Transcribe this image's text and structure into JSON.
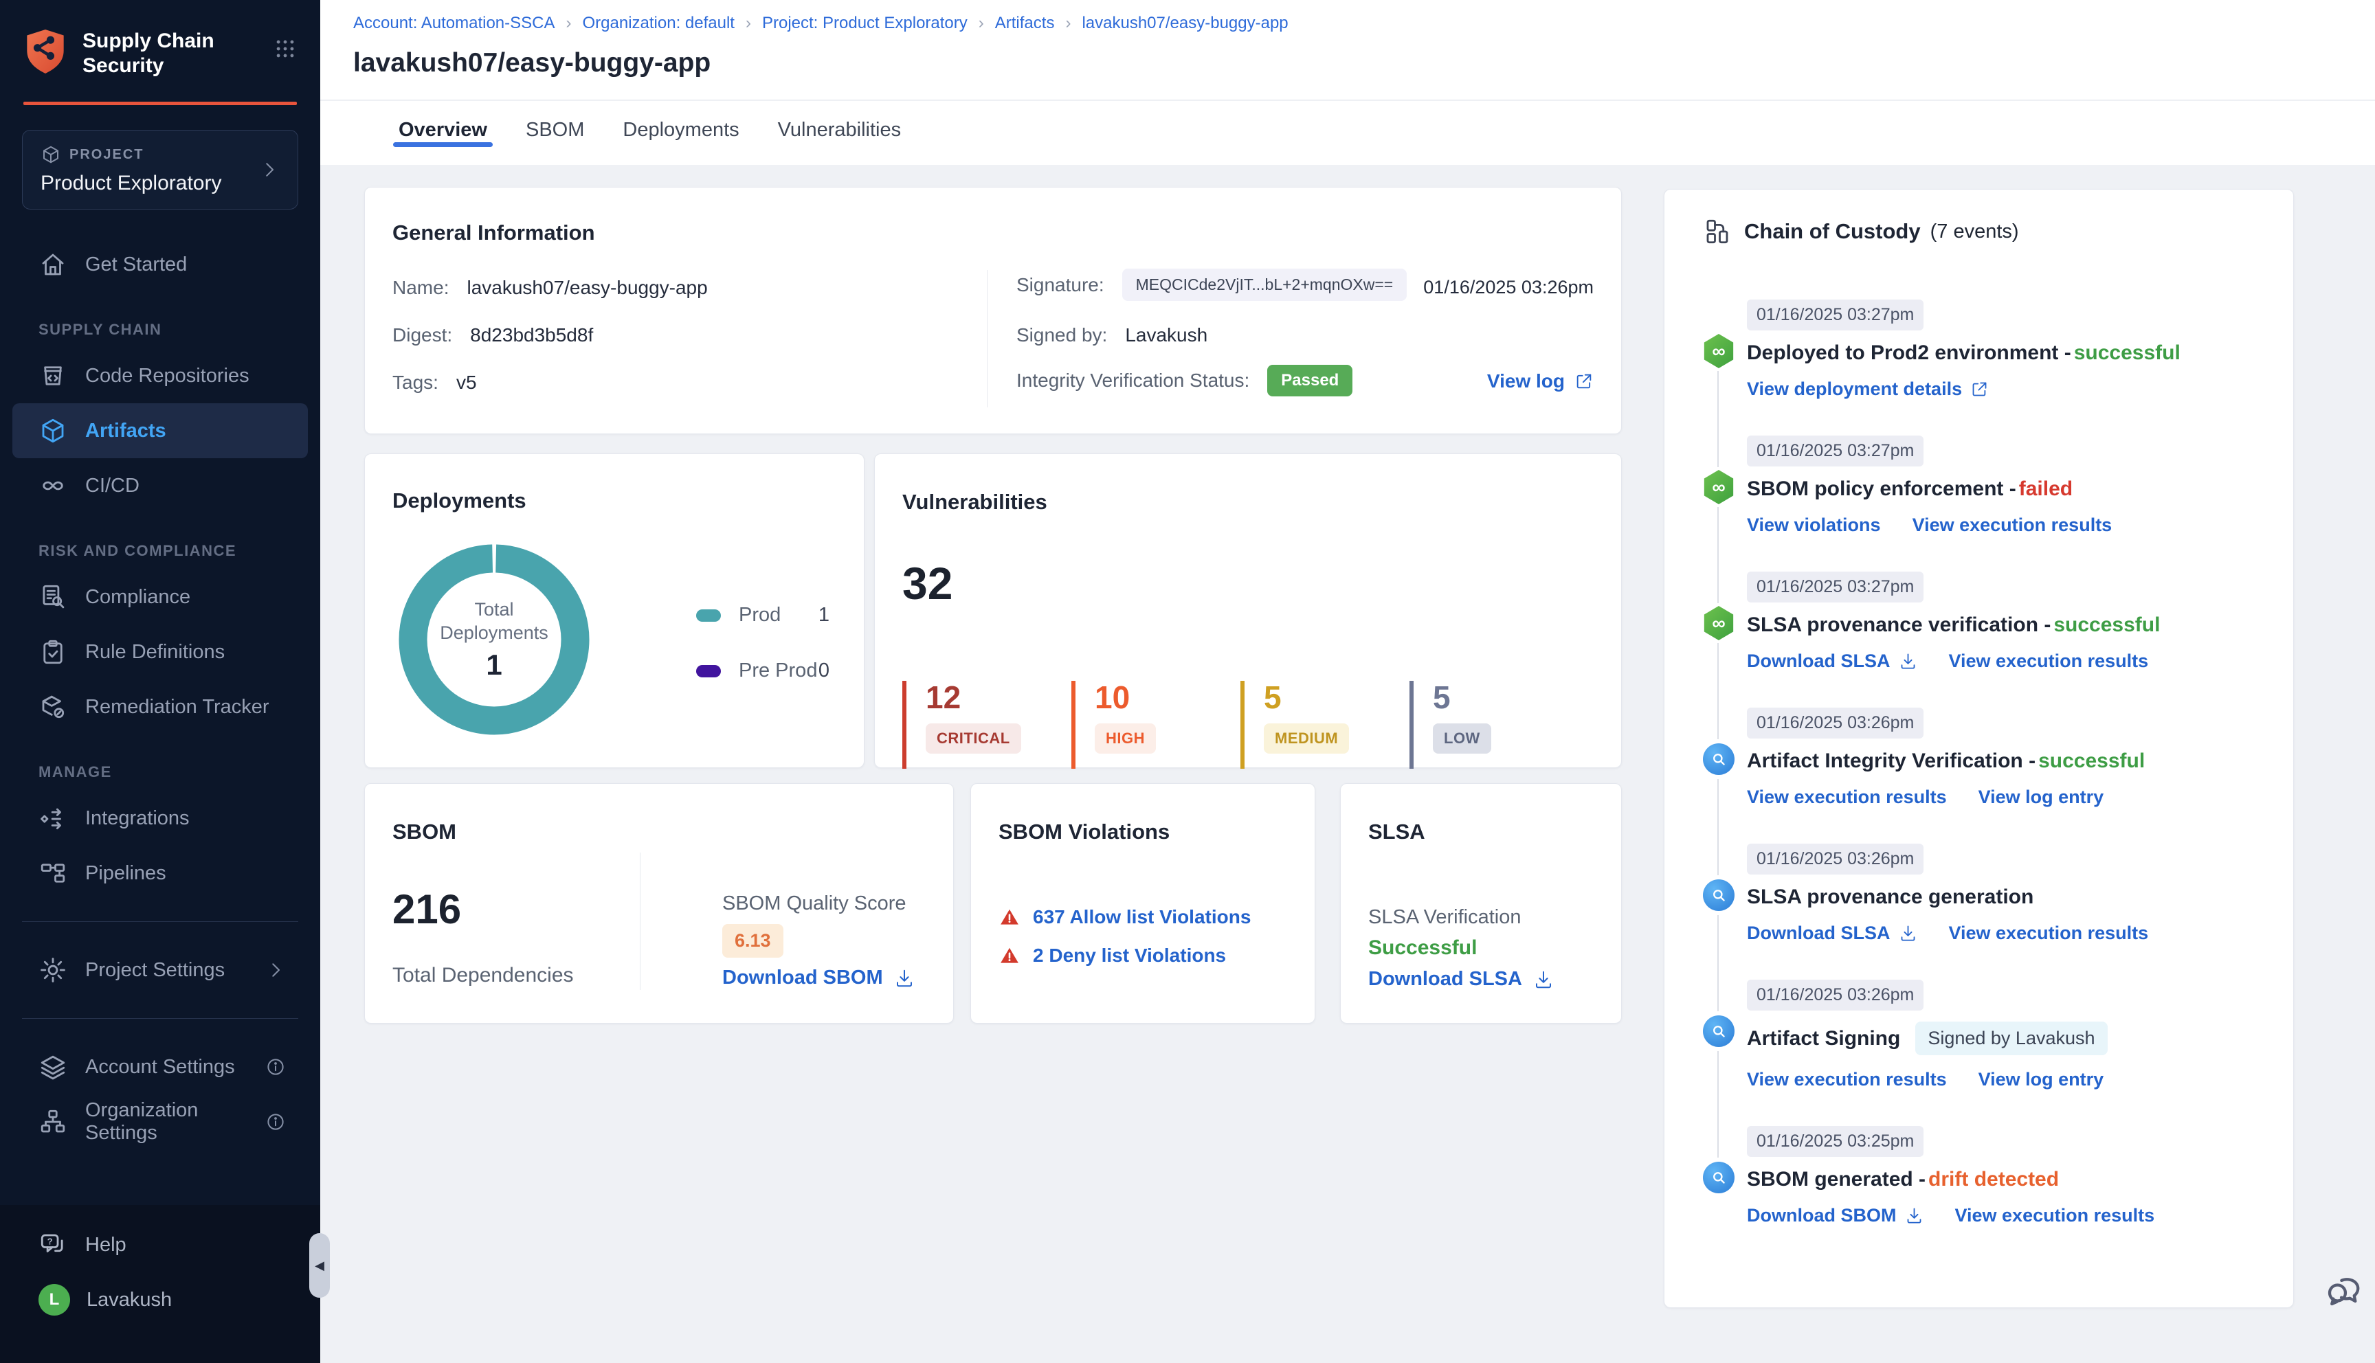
{
  "colors": {
    "accent_red": "#e8543c",
    "sidebar_active_blue": "#42a5f5",
    "breadcrumb_blue": "#2e6bd9",
    "link_blue": "#2463cc",
    "tab_underline": "#3a72e0",
    "passed_green": "#57ab57",
    "success_green": "#3e9d45",
    "failed_red": "#d6392e",
    "drift_orange": "#e7612e",
    "teal": "#49a4ad",
    "purple": "#41149e",
    "score_orange": "#e0703c"
  },
  "sidebar": {
    "product_name": "Supply Chain Security",
    "project_label": "PROJECT",
    "project_name": "Product Exploratory",
    "groups": [
      {
        "items": [
          {
            "label": "Get Started",
            "icon": "home"
          }
        ]
      },
      {
        "section": "SUPPLY CHAIN",
        "items": [
          {
            "label": "Code Repositories",
            "icon": "repo"
          },
          {
            "label": "Artifacts",
            "icon": "cube",
            "active": true
          },
          {
            "label": "CI/CD",
            "icon": "infinity"
          }
        ]
      },
      {
        "section": "RISK AND COMPLIANCE",
        "items": [
          {
            "label": "Compliance",
            "icon": "doc-search"
          },
          {
            "label": "Rule Definitions",
            "icon": "clipboard-check"
          },
          {
            "label": "Remediation Tracker",
            "icon": "box-tag"
          }
        ]
      },
      {
        "section": "MANAGE",
        "items": [
          {
            "label": "Integrations",
            "icon": "share-arrows"
          },
          {
            "label": "Pipelines",
            "icon": "pipeline"
          }
        ]
      }
    ],
    "settings_item": {
      "label": "Project Settings",
      "icon": "gear"
    },
    "admin_items": [
      {
        "label": "Account Settings",
        "icon": "layers"
      },
      {
        "label": "Organization Settings",
        "icon": "org-chart"
      }
    ],
    "help_label": "Help",
    "user": {
      "name": "Lavakush",
      "initial": "L"
    }
  },
  "breadcrumb": [
    "Account: Automation-SSCA",
    "Organization: default",
    "Project: Product Exploratory",
    "Artifacts",
    "lavakush07/easy-buggy-app"
  ],
  "page": {
    "title": "lavakush07/easy-buggy-app",
    "tabs": [
      {
        "label": "Overview",
        "active": true
      },
      {
        "label": "SBOM"
      },
      {
        "label": "Deployments"
      },
      {
        "label": "Vulnerabilities"
      }
    ]
  },
  "general_info": {
    "title": "General Information",
    "name_label": "Name:",
    "name": "lavakush07/easy-buggy-app",
    "digest_label": "Digest:",
    "digest": "8d23bd3b5d8f",
    "tags_label": "Tags:",
    "tags": "v5",
    "signature_label": "Signature:",
    "signature": "MEQCICde2VjIT...bL+2+mqnOXw==",
    "signature_date": "01/16/2025 03:26pm",
    "signed_by_label": "Signed by:",
    "signed_by": "Lavakush",
    "integrity_label": "Integrity Verification Status:",
    "integrity_status": "Passed",
    "view_log_label": "View log"
  },
  "deployments": {
    "title": "Deployments",
    "center_line1": "Total",
    "center_line2": "Deployments",
    "total": "1",
    "legend": [
      {
        "label": "Prod",
        "value": "1",
        "color": "#49a4ad"
      },
      {
        "label": "Pre Prod",
        "value": "0",
        "color": "#41149e"
      }
    ]
  },
  "vulnerabilities": {
    "title": "Vulnerabilities",
    "total": "32",
    "severities": [
      {
        "count": "12",
        "label": "CRITICAL",
        "number_color": "#a63a32",
        "bar_color": "#cc3d2e",
        "badge_bg": "#f7e9e8",
        "badge_color": "#a63a32"
      },
      {
        "count": "10",
        "label": "HIGH",
        "number_color": "#ec5b2d",
        "bar_color": "#ec5b2d",
        "badge_bg": "#fceee8",
        "badge_color": "#ec5b2d"
      },
      {
        "count": "5",
        "label": "MEDIUM",
        "number_color": "#cfa022",
        "bar_color": "#cfa022",
        "badge_bg": "#faf3da",
        "badge_color": "#bf9420"
      },
      {
        "count": "5",
        "label": "LOW",
        "number_color": "#6d7693",
        "bar_color": "#6d7693",
        "badge_bg": "#dcdfe8",
        "badge_color": "#5d6680"
      }
    ]
  },
  "sbom": {
    "title": "SBOM",
    "total": "216",
    "total_label": "Total Dependencies",
    "quality_label": "SBOM Quality Score",
    "score": "6.13",
    "download_label": "Download SBOM"
  },
  "sbom_violations": {
    "title": "SBOM Violations",
    "items": [
      {
        "text": "637 Allow list Violations"
      },
      {
        "text": "2 Deny list Violations"
      }
    ]
  },
  "slsa": {
    "title": "SLSA",
    "verification_label": "SLSA Verification",
    "status": "Successful",
    "download_label": "Download SLSA"
  },
  "chain_of_custody": {
    "title": "Chain of Custody",
    "count": "(7 events)",
    "events": [
      {
        "ts": "01/16/2025 03:27pm",
        "icon": "pipeline-hex",
        "title": "Deployed to Prod2 environment",
        "status": {
          "text": "successful",
          "type": "success"
        },
        "links": [
          {
            "label": "View deployment details",
            "icon": "external"
          }
        ]
      },
      {
        "ts": "01/16/2025 03:27pm",
        "icon": "pipeline-hex",
        "title": "SBOM policy enforcement",
        "status": {
          "text": "failed",
          "type": "fail"
        },
        "links": [
          {
            "label": "View violations"
          },
          {
            "label": "View execution results"
          }
        ]
      },
      {
        "ts": "01/16/2025 03:27pm",
        "icon": "pipeline-hex",
        "title": "SLSA provenance verification",
        "status": {
          "text": "successful",
          "type": "success"
        },
        "links": [
          {
            "label": "Download SLSA",
            "icon": "download"
          },
          {
            "label": "View execution results"
          }
        ]
      },
      {
        "ts": "01/16/2025 03:26pm",
        "icon": "scan-circle",
        "title": "Artifact Integrity Verification",
        "status": {
          "text": "successful",
          "type": "success"
        },
        "links": [
          {
            "label": "View execution results"
          },
          {
            "label": "View log entry"
          }
        ]
      },
      {
        "ts": "01/16/2025 03:26pm",
        "icon": "scan-circle",
        "title": "SLSA provenance generation",
        "links": [
          {
            "label": "Download SLSA",
            "icon": "download"
          },
          {
            "label": "View execution results"
          }
        ]
      },
      {
        "ts": "01/16/2025 03:26pm",
        "icon": "scan-circle",
        "title": "Artifact Signing",
        "badge": "Signed by Lavakush",
        "links": [
          {
            "label": "View execution results"
          },
          {
            "label": "View log entry"
          }
        ]
      },
      {
        "ts": "01/16/2025 03:25pm",
        "icon": "scan-circle",
        "title": "SBOM generated",
        "status": {
          "text": "drift detected",
          "type": "drift"
        },
        "links": [
          {
            "label": "Download SBOM",
            "icon": "download"
          },
          {
            "label": "View execution results"
          }
        ]
      }
    ]
  },
  "chart_data": {
    "type": "pie",
    "title": "Deployments",
    "categories": [
      "Prod",
      "Pre Prod"
    ],
    "values": [
      1,
      0
    ],
    "colors": [
      "#49a4ad",
      "#41149e"
    ],
    "center_label": "Total Deployments",
    "total": 1,
    "legend_position": "right"
  }
}
